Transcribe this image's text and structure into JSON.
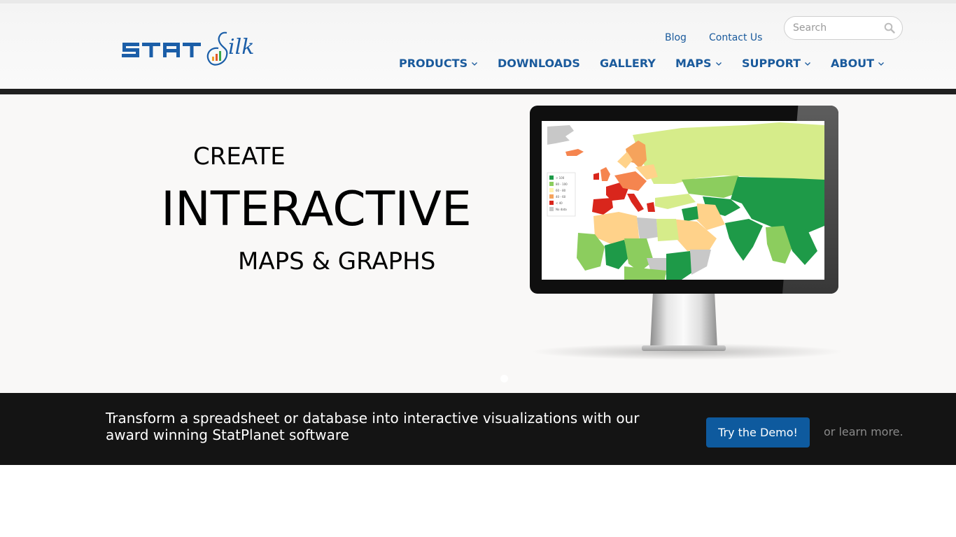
{
  "brand": {
    "logo_text_left": "STAT",
    "logo_text_right": "Silk",
    "logo_blue": "#1b5ea8",
    "logo_bar_colors": [
      "#f0a02a",
      "#e2572b",
      "#3aa94a"
    ]
  },
  "header": {
    "top_links": [
      {
        "label": "Blog"
      },
      {
        "label": "Contact Us"
      }
    ],
    "search": {
      "placeholder": "Search",
      "value": "",
      "icon": "search-icon"
    },
    "nav": [
      {
        "label": "PRODUCTS",
        "has_dropdown": true
      },
      {
        "label": "DOWNLOADS",
        "has_dropdown": false
      },
      {
        "label": "GALLERY",
        "has_dropdown": false
      },
      {
        "label": "MAPS",
        "has_dropdown": true
      },
      {
        "label": "SUPPORT",
        "has_dropdown": true
      },
      {
        "label": "ABOUT",
        "has_dropdown": true
      }
    ],
    "link_color": "#1a5a9c"
  },
  "hero": {
    "line1": "CREATE",
    "line2": "INTERACTIVE",
    "line3": "MAPS & GRAPHS",
    "slide_count_visible": 1,
    "active_slide": 1,
    "map_legend": [
      {
        "label": "> 100",
        "color": "#1e9a48"
      },
      {
        "label": "80 - 100",
        "color": "#8ccd5e"
      },
      {
        "label": "60 - 80",
        "color": "#fff3b0"
      },
      {
        "label": "40 - 60",
        "color": "#f5a35c"
      },
      {
        "label": "< 40",
        "color": "#d9261c"
      },
      {
        "label": "No data",
        "color": "#c8c8c8"
      }
    ]
  },
  "cta": {
    "text": "Transform a spreadsheet or database into interactive visualizations with our award winning StatPlanet software",
    "button_label": "Try the Demo!",
    "secondary_link": "or learn more.",
    "button_color": "#0e5a9e"
  }
}
